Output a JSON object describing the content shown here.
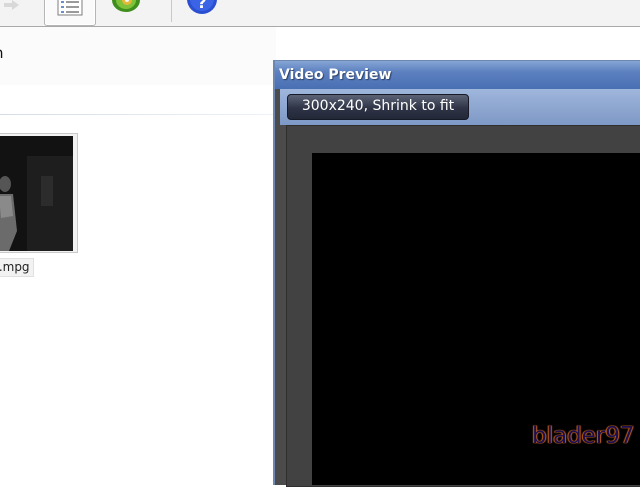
{
  "toolbar": {
    "buttons": [
      {
        "name": "back-arrow-icon"
      },
      {
        "name": "list-view-icon"
      },
      {
        "name": "media-disc-icon"
      },
      {
        "name": "help-icon",
        "glyph": "?"
      }
    ]
  },
  "left_panel": {
    "title": "n",
    "thumbnail": {
      "caption": "..mpg"
    }
  },
  "video_preview": {
    "title": "Video Preview",
    "size_label": "300x240, Shrink to fit",
    "watermark": "blader97"
  },
  "colors": {
    "titlebar": "#5b7fbf",
    "pill": "#2e3446",
    "video_bg": "#000000",
    "watermark_glow": "#d07020"
  }
}
